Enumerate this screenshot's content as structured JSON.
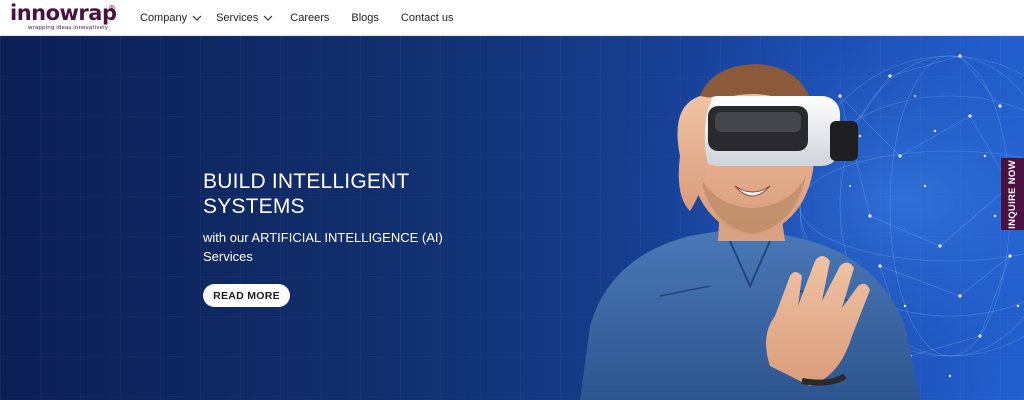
{
  "brand": {
    "name": "innowrap",
    "registered": "®",
    "tagline": "wrapping ideas innovatively",
    "color": "#4a1140"
  },
  "nav": {
    "items": [
      {
        "label": "Company",
        "has_dropdown": true
      },
      {
        "label": "Services",
        "has_dropdown": true
      },
      {
        "label": "Careers",
        "has_dropdown": false
      },
      {
        "label": "Blogs",
        "has_dropdown": false
      },
      {
        "label": "Contact us",
        "has_dropdown": false
      }
    ]
  },
  "hero": {
    "title": "BUILD INTELLIGENT SYSTEMS",
    "subtitle": "with our ARTIFICIAL INTELLIGENCE (AI) Services",
    "cta_label": "READ MORE",
    "image": "man-wearing-vr-headset",
    "background_color": "#11306f"
  },
  "side_tab": {
    "label": "INQUIRE NOW",
    "color": "#4a1140"
  }
}
